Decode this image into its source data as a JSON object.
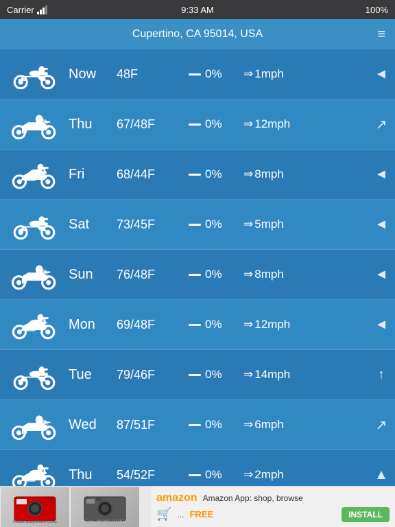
{
  "statusBar": {
    "carrier": "Carrier",
    "time": "9:33 AM",
    "battery": "100%",
    "signal": "WiFi"
  },
  "header": {
    "title": "Cupertino, CA 95014, USA",
    "menuIcon": "≡"
  },
  "rows": [
    {
      "id": "now",
      "day": "Now",
      "temp": "48F",
      "precip": "0%",
      "wind": "1mph",
      "direction": "◄",
      "motoStyle": 1
    },
    {
      "id": "thu1",
      "day": "Thu",
      "temp": "67/48F",
      "precip": "0%",
      "wind": "12mph",
      "direction": "↗",
      "motoStyle": 2
    },
    {
      "id": "fri",
      "day": "Fri",
      "temp": "68/44F",
      "precip": "0%",
      "wind": "8mph",
      "direction": "◄",
      "motoStyle": 3
    },
    {
      "id": "sat",
      "day": "Sat",
      "temp": "73/45F",
      "precip": "0%",
      "wind": "5mph",
      "direction": "◄",
      "motoStyle": 1
    },
    {
      "id": "sun",
      "day": "Sun",
      "temp": "76/48F",
      "precip": "0%",
      "wind": "8mph",
      "direction": "◄",
      "motoStyle": 2
    },
    {
      "id": "mon",
      "day": "Mon",
      "temp": "69/48F",
      "precip": "0%",
      "wind": "12mph",
      "direction": "◄",
      "motoStyle": 3
    },
    {
      "id": "tue",
      "day": "Tue",
      "temp": "79/46F",
      "precip": "0%",
      "wind": "14mph",
      "direction": "↑",
      "motoStyle": 1
    },
    {
      "id": "wed",
      "day": "Wed",
      "temp": "87/51F",
      "precip": "0%",
      "wind": "6mph",
      "direction": "↗",
      "motoStyle": 2
    },
    {
      "id": "thu2",
      "day": "Thu",
      "temp": "54/52F",
      "precip": "0%",
      "wind": "2mph",
      "direction": "▲",
      "motoStyle": 3
    }
  ],
  "ad": {
    "image1": "Kodak EasyShare C195",
    "image2": "Sony W800/B 20 MP",
    "brand": "amazon",
    "text": "Amazon App: shop, browse",
    "dots": "...",
    "free": "FREE",
    "installLabel": "INSTALL"
  }
}
